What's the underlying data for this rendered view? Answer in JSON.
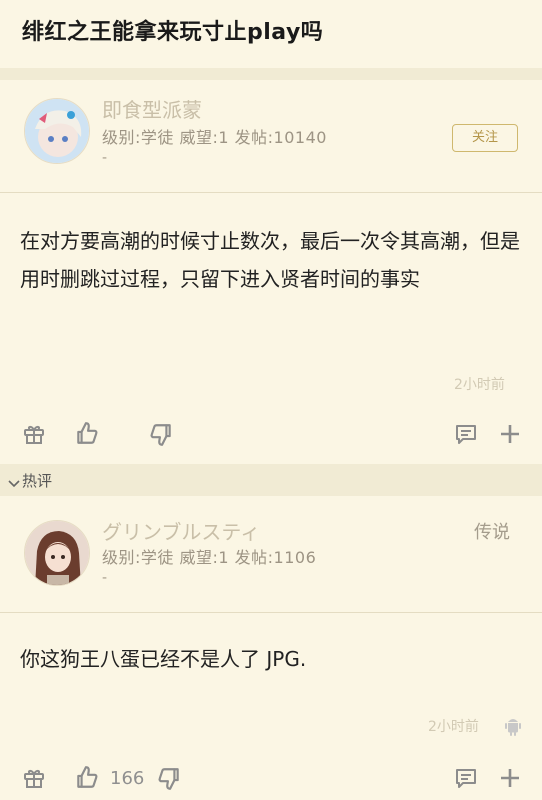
{
  "thread": {
    "title": "绯红之王能拿来玩寸止play吗"
  },
  "post": {
    "username": "即食型派蒙",
    "user_info": "级别:学徒 威望:1 发帖:10140",
    "dash": "-",
    "follow_label": "关注",
    "text": "在对方要高潮的时候寸止数次，最后一次令其高潮，但是用时删跳过过程，只留下进入贤者时间的事实",
    "time": "2小时前"
  },
  "hot_section": {
    "label": "热评"
  },
  "reply": {
    "username": "グリンブルスティ",
    "user_info": "级别:学徒 威望:1 发帖:1106",
    "dash": "-",
    "tag": "传说",
    "text": "你这狗王八蛋已经不是人了 JPG.",
    "time": "2小时前",
    "like_count": "166"
  },
  "colors": {
    "background": "#fbf6e4",
    "band": "#f1ebd4",
    "follow_border": "#cfb86e"
  },
  "icons": [
    "gift-icon",
    "thumbs-up-icon",
    "thumbs-down-icon",
    "comment-icon",
    "plus-icon",
    "android-icon",
    "chevron-down-icon"
  ]
}
